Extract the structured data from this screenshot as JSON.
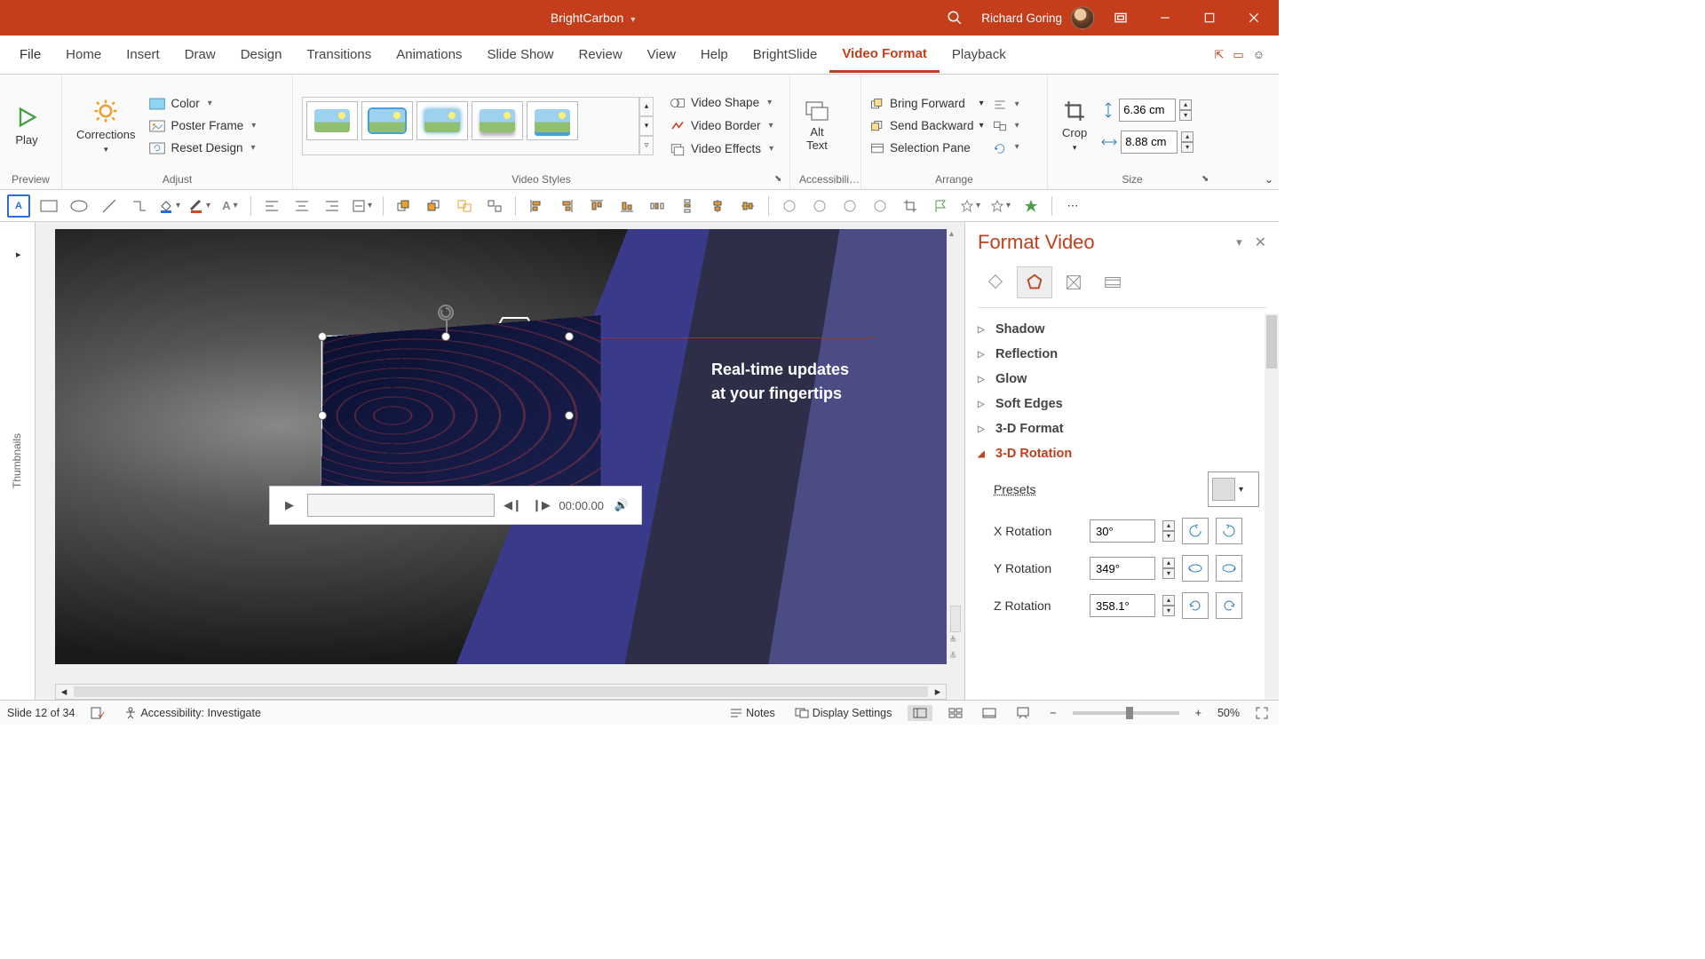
{
  "title": "BrightCarbon",
  "user": "Richard Goring",
  "tabs": [
    "File",
    "Home",
    "Insert",
    "Draw",
    "Design",
    "Transitions",
    "Animations",
    "Slide Show",
    "Review",
    "View",
    "Help",
    "BrightSlide",
    "Video Format",
    "Playback"
  ],
  "active_tab": "Video Format",
  "ribbon": {
    "preview": {
      "play": "Play",
      "label": "Preview"
    },
    "adjust": {
      "corrections": "Corrections",
      "color": "Color",
      "poster": "Poster Frame",
      "reset": "Reset Design",
      "label": "Adjust"
    },
    "styles": {
      "shape": "Video Shape",
      "border": "Video Border",
      "effects": "Video Effects",
      "label": "Video Styles"
    },
    "acc": {
      "alt": "Alt\nText",
      "label": "Accessibili…"
    },
    "arrange": {
      "fwd": "Bring Forward",
      "back": "Send Backward",
      "sel": "Selection Pane",
      "label": "Arrange"
    },
    "size": {
      "crop": "Crop",
      "h": "6.36 cm",
      "w": "8.88 cm",
      "label": "Size"
    }
  },
  "slide": {
    "caption1": "Real-time updates",
    "caption2": "at your fingertips",
    "time": "00:00.00"
  },
  "pane": {
    "title": "Format Video",
    "sections": [
      "Shadow",
      "Reflection",
      "Glow",
      "Soft Edges",
      "3-D Format",
      "3-D Rotation"
    ],
    "active_section": "3-D Rotation",
    "presets": "Presets",
    "rot": {
      "x_label": "X Rotation",
      "x": "30°",
      "y_label": "Y Rotation",
      "y": "349°",
      "z_label": "Z Rotation",
      "z": "358.1°"
    }
  },
  "thumbnails_label": "Thumbnails",
  "status": {
    "slide": "Slide 12 of 34",
    "acc": "Accessibility: Investigate",
    "notes": "Notes",
    "display": "Display Settings",
    "zoom": "50%"
  }
}
